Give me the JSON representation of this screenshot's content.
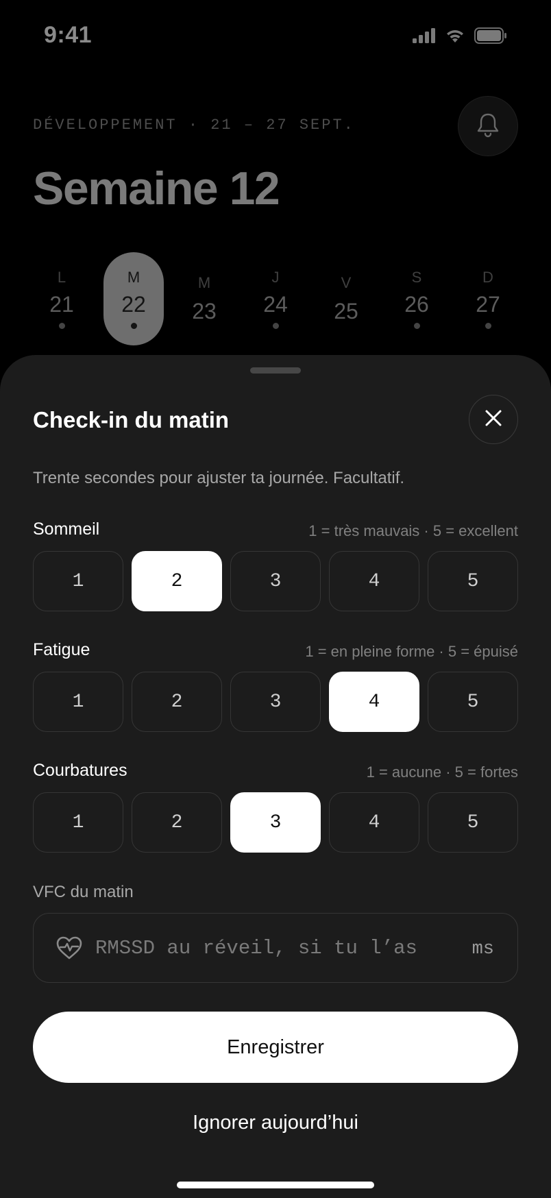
{
  "status_bar": {
    "time": "9:41",
    "signal_icon": "cellular-signal-icon",
    "wifi_icon": "wifi-icon",
    "battery_icon": "battery-icon"
  },
  "header": {
    "eyebrow": "DÉVELOPPEMENT · 21 – 27 SEPT.",
    "title": "Semaine 12",
    "bell_icon": "bell-icon"
  },
  "week": {
    "days": [
      {
        "letter": "L",
        "num": "21",
        "has_entry": true,
        "selected": false
      },
      {
        "letter": "M",
        "num": "22",
        "has_entry": true,
        "selected": true
      },
      {
        "letter": "M",
        "num": "23",
        "has_entry": false,
        "selected": false
      },
      {
        "letter": "J",
        "num": "24",
        "has_entry": true,
        "selected": false
      },
      {
        "letter": "V",
        "num": "25",
        "has_entry": false,
        "selected": false
      },
      {
        "letter": "S",
        "num": "26",
        "has_entry": true,
        "selected": false
      },
      {
        "letter": "D",
        "num": "27",
        "has_entry": true,
        "selected": false
      }
    ]
  },
  "sheet": {
    "title": "Check-in du matin",
    "close_icon": "close-icon",
    "subtitle": "Trente secondes pour ajuster ta journée. Facultatif.",
    "ratings": [
      {
        "label": "Sommeil",
        "hint": "1 = très mauvais · 5 = excellent",
        "options": [
          "1",
          "2",
          "3",
          "4",
          "5"
        ],
        "selected": "2"
      },
      {
        "label": "Fatigue",
        "hint": "1 = en pleine forme · 5 = épuisé",
        "options": [
          "1",
          "2",
          "3",
          "4",
          "5"
        ],
        "selected": "4"
      },
      {
        "label": "Courbatures",
        "hint": "1 = aucune · 5 = fortes",
        "options": [
          "1",
          "2",
          "3",
          "4",
          "5"
        ],
        "selected": "3"
      }
    ],
    "hrv": {
      "label": "VFC du matin",
      "icon": "heart-pulse-icon",
      "placeholder": "RMSSD au réveil, si tu l’as",
      "value": "",
      "unit": "ms"
    },
    "save_label": "Enregistrer",
    "skip_label": "Ignorer aujourd’hui"
  },
  "colors": {
    "background": "#000000",
    "sheet": "#1c1c1c",
    "accent": "#ffffff"
  }
}
